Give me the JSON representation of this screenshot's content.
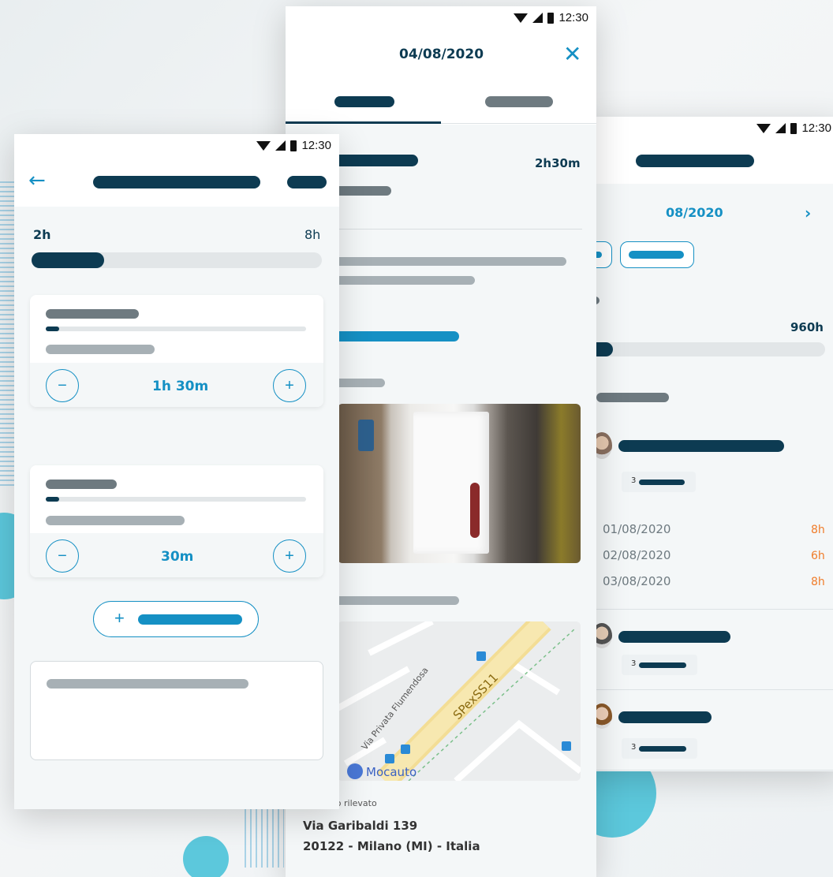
{
  "status": {
    "time": "12:30"
  },
  "left": {
    "hours_done": "2h",
    "hours_total": "8h",
    "progress": 0.25,
    "entries": [
      {
        "duration": "1h 30m",
        "progress": 0.05
      },
      {
        "duration": "30m",
        "progress": 0.05
      }
    ],
    "minus_icon": "minus-icon",
    "plus_icon": "plus-icon",
    "add_symbol": "+"
  },
  "center": {
    "date": "04/08/2020",
    "duration": "2h30m",
    "location_label": "zo rilevato",
    "address_line1": "Via Garibaldi 139",
    "address_line2": "20122 - Milano (MI) - Italia",
    "map": {
      "road_label": "SPexSS11",
      "street_label": "Via Privata Flumendosa",
      "poi_label": "Mocauto"
    }
  },
  "right": {
    "month": "08/2020",
    "total_hours": "960h",
    "progress": 0.12,
    "people": [
      {
        "count": "3",
        "days": [
          {
            "date": "01/08/2020",
            "hours": "8h"
          },
          {
            "date": "02/08/2020",
            "hours": "6h"
          },
          {
            "date": "03/08/2020",
            "hours": "8h"
          }
        ]
      },
      {
        "count": "3"
      },
      {
        "count": "3"
      }
    ]
  },
  "colors": {
    "dark": "#0d3b52",
    "accent": "#1590c4",
    "hours_orange": "#f07c2a"
  }
}
